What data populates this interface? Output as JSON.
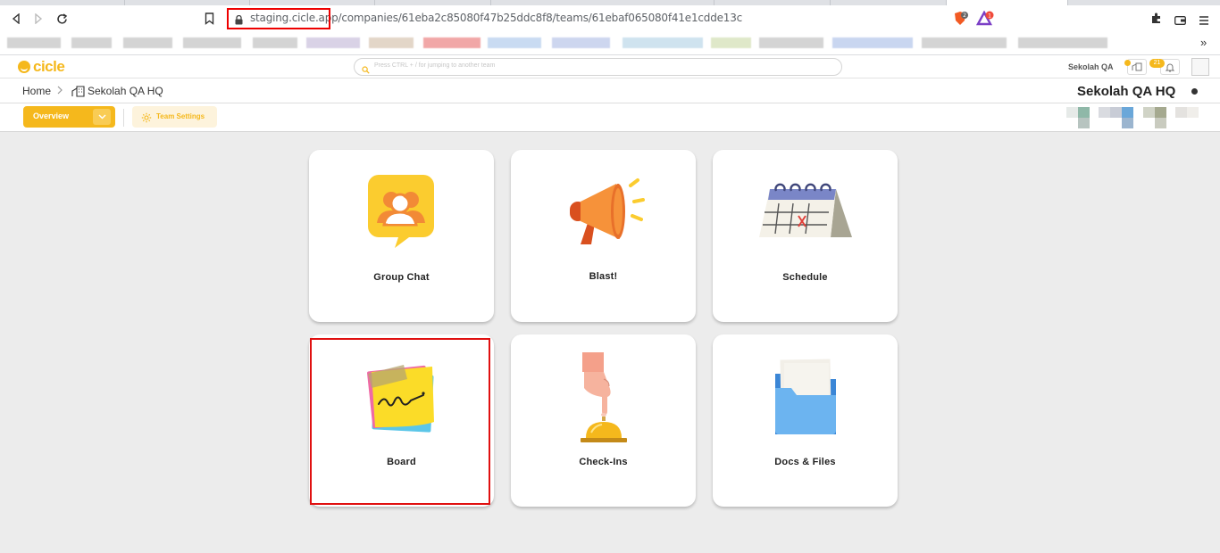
{
  "browser": {
    "url": "staging.cicle.app/companies/61eba2c85080f47b25ddc8f8/teams/61ebaf065080f41e1cdde13c"
  },
  "header": {
    "logo_text": "cicle",
    "search_placeholder": "Press CTRL + / for jumping to another team",
    "company_name": "Sekolah QA",
    "notification_count": "21"
  },
  "breadcrumb": {
    "home": "Home",
    "team": "Sekolah QA HQ"
  },
  "team_title": "Sekolah QA HQ",
  "tabs": {
    "overview": "Overview",
    "settings": "Team Settings"
  },
  "cards": [
    {
      "label": "Group Chat",
      "icon": "group-chat-icon"
    },
    {
      "label": "Blast!",
      "icon": "megaphone-icon"
    },
    {
      "label": "Schedule",
      "icon": "calendar-icon"
    },
    {
      "label": "Board",
      "icon": "sticky-note-icon"
    },
    {
      "label": "Check-Ins",
      "icon": "service-bell-icon"
    },
    {
      "label": "Docs & Files",
      "icon": "folder-icon"
    }
  ],
  "colors": {
    "brand": "#f5b81c",
    "highlight": "#e01010"
  }
}
